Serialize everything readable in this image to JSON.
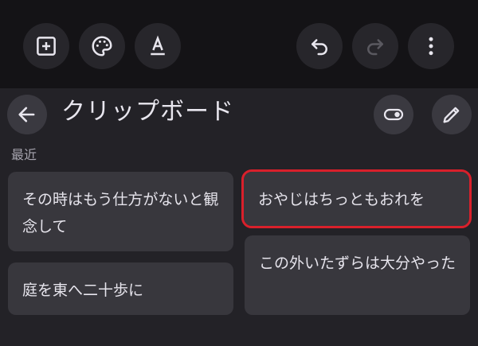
{
  "toolbar": {
    "buttons": [
      {
        "name": "add-box-icon"
      },
      {
        "name": "palette-icon"
      },
      {
        "name": "text-format-icon"
      },
      {
        "name": "undo-icon"
      },
      {
        "name": "redo-icon"
      },
      {
        "name": "more-vert-icon"
      }
    ]
  },
  "clipboard": {
    "title": "クリップボード",
    "section_label": "最近",
    "items": [
      {
        "text": "その時はもう仕方がないと観念して"
      },
      {
        "text": "おやじはちっともおれを"
      },
      {
        "text": "庭を東へ二十歩に"
      },
      {
        "text": "この外いたずらは大分やった"
      }
    ]
  },
  "colors": {
    "selection_outline": "#d9202b",
    "chip_bg": "#38373d",
    "panel_bg": "#232227"
  }
}
